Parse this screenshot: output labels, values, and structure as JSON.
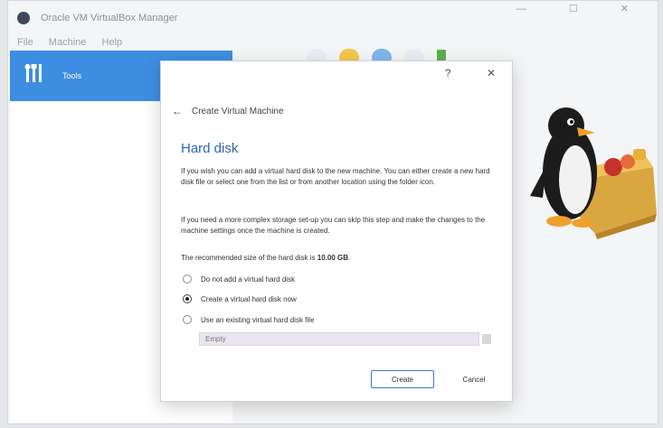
{
  "app": {
    "title": "Oracle VM VirtualBox Manager",
    "window_controls": "— ☐ ✕"
  },
  "menu": [
    "File",
    "Machine",
    "Help"
  ],
  "sidebar": {
    "tools_label": "Tools",
    "tools_icon": "tools-icon"
  },
  "toolbar": {
    "icons": [
      {
        "name": "gear-icon",
        "color": "#e9eef4"
      },
      {
        "name": "new-vm-icon",
        "color": "#f2c84b"
      },
      {
        "name": "add-icon",
        "color": "#7fb7ea"
      },
      {
        "name": "import-icon",
        "color": "#e9eef4"
      },
      {
        "name": "export-icon",
        "color": "#5bb04e"
      }
    ]
  },
  "dialog": {
    "controls": {
      "help": "?",
      "close": "✕"
    },
    "header": "Create Virtual Machine",
    "back_icon": "back-arrow-icon",
    "section_title": "Hard disk",
    "para1": "If you wish you can add a virtual hard disk to the new machine. You can either create a new hard disk file or select one from the list or from another location using the folder icon.",
    "para2": "If you need a more complex storage set-up you can skip this step and make the changes to the machine settings once the machine is created.",
    "recommended_prefix": "The recommended size of the hard disk is",
    "recommended_size": "10.00 GB",
    "options": [
      {
        "label": "Do not add a virtual hard disk",
        "checked": false
      },
      {
        "label": "Create a virtual hard disk now",
        "checked": true
      },
      {
        "label": "Use an existing virtual hard disk file",
        "checked": false
      }
    ],
    "file_combo_value": "Empty",
    "create_label": "Create",
    "cancel_label": "Cancel"
  },
  "colors": {
    "accent": "#3d8ee0",
    "title": "#2f65b7"
  }
}
